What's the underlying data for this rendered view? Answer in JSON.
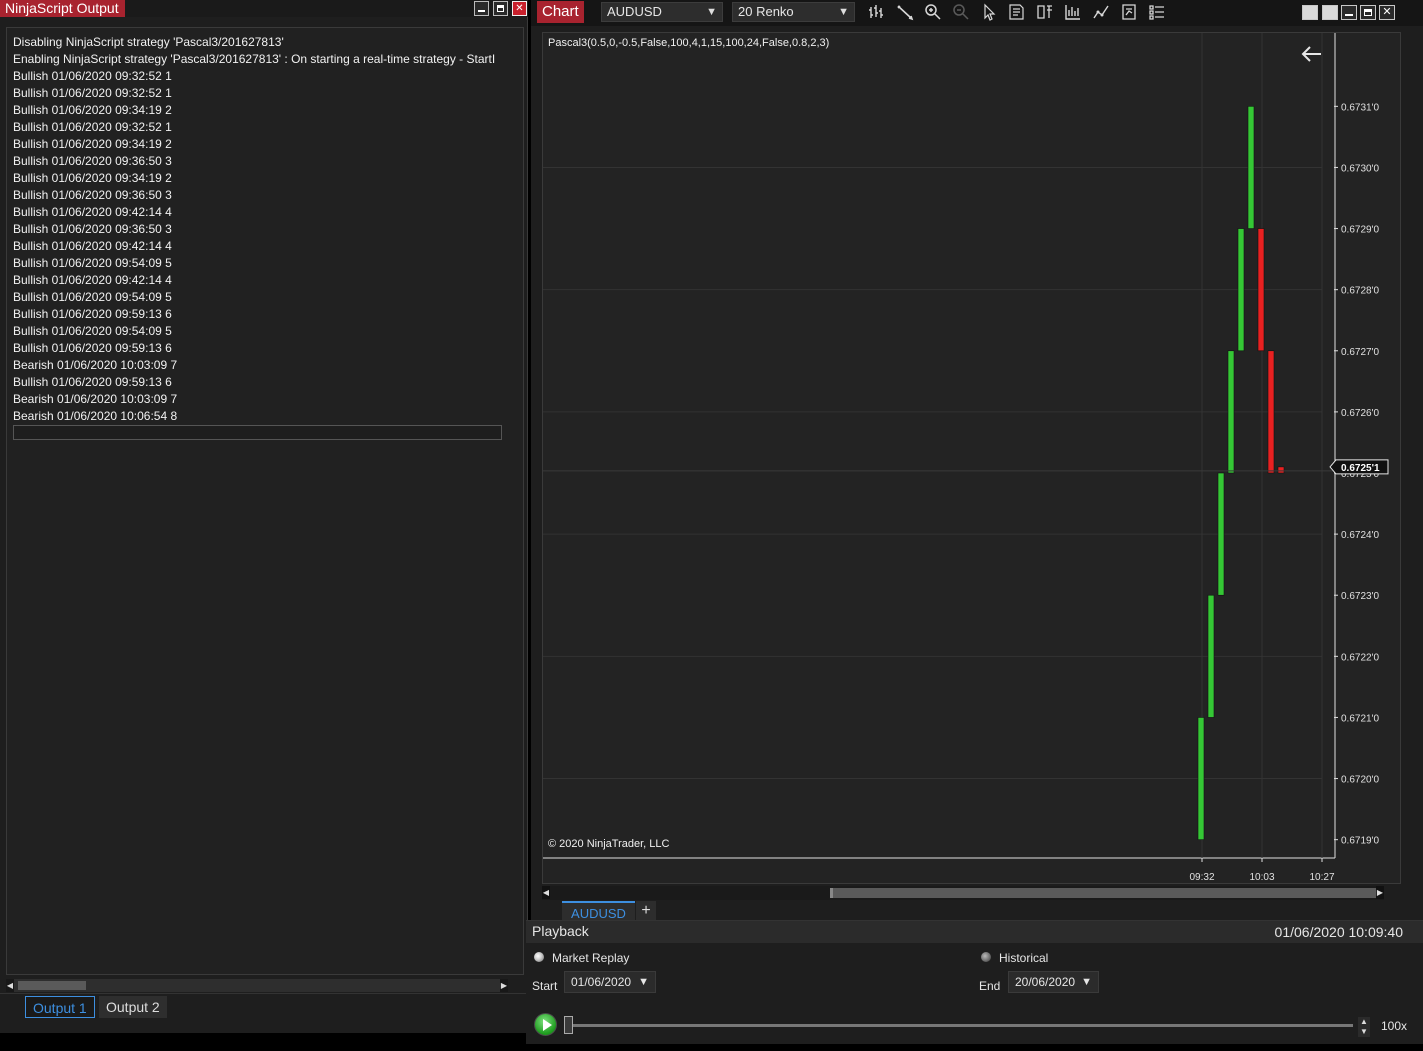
{
  "output_window": {
    "title": "NinjaScript Output",
    "lines": [
      "Disabling NinjaScript strategy 'Pascal3/201627813'",
      "Enabling NinjaScript strategy 'Pascal3/201627813' : On starting a real-time strategy - StartI",
      "Bullish 01/06/2020 09:32:52 1",
      "Bullish 01/06/2020 09:32:52 1",
      "Bullish 01/06/2020 09:34:19 2",
      "Bullish 01/06/2020 09:32:52 1",
      "Bullish 01/06/2020 09:34:19 2",
      "Bullish 01/06/2020 09:36:50 3",
      "Bullish 01/06/2020 09:34:19 2",
      "Bullish 01/06/2020 09:36:50 3",
      "Bullish 01/06/2020 09:42:14 4",
      "Bullish 01/06/2020 09:36:50 3",
      "Bullish 01/06/2020 09:42:14 4",
      "Bullish 01/06/2020 09:54:09 5",
      "Bullish 01/06/2020 09:42:14 4",
      "Bullish 01/06/2020 09:54:09 5",
      "Bullish 01/06/2020 09:59:13 6",
      "Bullish 01/06/2020 09:54:09 5",
      "Bullish 01/06/2020 09:59:13 6",
      "Bearish 01/06/2020 10:03:09 7",
      "Bullish 01/06/2020 09:59:13 6",
      "Bearish 01/06/2020 10:03:09 7",
      "Bearish 01/06/2020 10:06:54 8"
    ],
    "tabs": [
      "Output 1",
      "Output 2"
    ],
    "active_tab": "Output 1"
  },
  "chart_window": {
    "title": "Chart",
    "instrument": "AUDUSD",
    "bar_type": "20 Renko",
    "toolbar_icons": [
      "bar-type-icon",
      "drawing-tools-icon",
      "zoom-in-icon",
      "zoom-out-icon",
      "pointer-icon",
      "data-box-icon",
      "properties-icon",
      "indicators-icon",
      "strategies-icon",
      "chart-trader-icon",
      "templates-icon"
    ],
    "indicator_label": "Pascal3(0.5,0,-0.5,False,100,4,1,15,100,24,False,0.8,2,3)",
    "copyright": "© 2020 NinjaTrader, LLC",
    "tabs": [
      "AUDUSD"
    ],
    "add_tab_label": "+"
  },
  "chart_data": {
    "type": "candlestick",
    "y_ticks": [
      "0.6731'0",
      "0.6730'0",
      "0.6729'0",
      "0.6728'0",
      "0.6727'0",
      "0.6726'0",
      "0.6725'0",
      "0.6724'0",
      "0.6723'0",
      "0.6722'0",
      "0.6721'0",
      "0.6720'0",
      "0.6719'0"
    ],
    "y_tick_values": [
      0.6731,
      0.673,
      0.6729,
      0.6728,
      0.6727,
      0.6726,
      0.6725,
      0.6724,
      0.6723,
      0.6722,
      0.6721,
      0.672,
      0.6719
    ],
    "ylim": [
      0.67187,
      0.67322
    ],
    "x_ticks": [
      "09:32",
      "10:03",
      "10:27"
    ],
    "current_price_label": "0.6725'1",
    "current_price": 0.67251,
    "bars": [
      {
        "open": 0.6719,
        "close": 0.6721,
        "dir": "up"
      },
      {
        "open": 0.6721,
        "close": 0.6723,
        "dir": "up"
      },
      {
        "open": 0.6723,
        "close": 0.6725,
        "dir": "up"
      },
      {
        "open": 0.6725,
        "close": 0.6727,
        "dir": "up"
      },
      {
        "open": 0.6727,
        "close": 0.6729,
        "dir": "up"
      },
      {
        "open": 0.6729,
        "close": 0.6731,
        "dir": "up"
      },
      {
        "open": 0.6729,
        "close": 0.6727,
        "dir": "down"
      },
      {
        "open": 0.6727,
        "close": 0.6725,
        "dir": "down"
      },
      {
        "open": 0.67251,
        "close": 0.6725,
        "dir": "down"
      }
    ],
    "colors": {
      "up": "#35c735",
      "down": "#e82121",
      "grid": "#333333",
      "axis": "#e0e0e0",
      "background": "#232323"
    }
  },
  "playback": {
    "title": "Playback",
    "current_time": "01/06/2020 10:09:40",
    "market_replay_label": "Market Replay",
    "historical_label": "Historical",
    "start_label": "Start",
    "start_value": "01/06/2020",
    "end_label": "End",
    "end_value": "20/06/2020",
    "speed": "100x",
    "progress_fraction": 0.0
  }
}
